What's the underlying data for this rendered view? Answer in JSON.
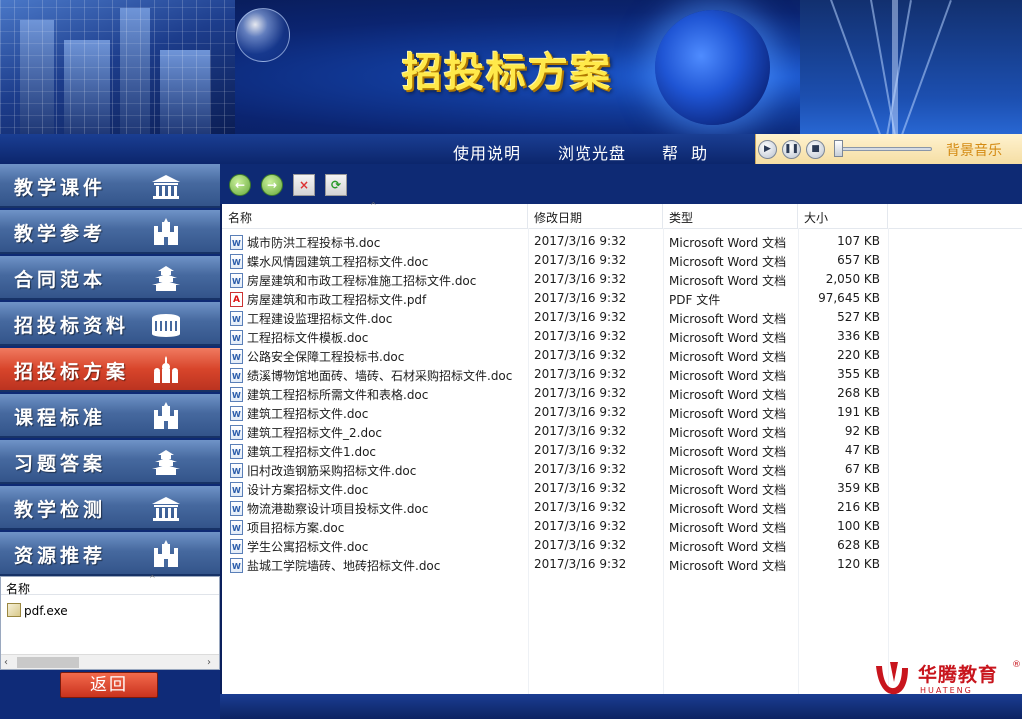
{
  "banner": {
    "title": "招投标方案"
  },
  "menu": {
    "items": [
      "使用说明",
      "浏览光盘",
      "帮  助"
    ]
  },
  "player": {
    "label": "背景音乐",
    "play_icon": "play-icon",
    "pause_icon": "pause-icon",
    "stop_icon": "stop-icon"
  },
  "nav": {
    "items": [
      {
        "label": "教学课件",
        "icon": "temple-icon",
        "active": false
      },
      {
        "label": "教学参考",
        "icon": "palace-icon",
        "active": false
      },
      {
        "label": "合同范本",
        "icon": "pagoda-icon",
        "active": false
      },
      {
        "label": "招投标资料",
        "icon": "colosseum-icon",
        "active": false
      },
      {
        "label": "招投标方案",
        "icon": "kremlin-icon",
        "active": true
      },
      {
        "label": "课程标准",
        "icon": "palace-icon",
        "active": false
      },
      {
        "label": "习题答案",
        "icon": "pagoda-icon",
        "active": false
      },
      {
        "label": "教学检测",
        "icon": "temple-icon",
        "active": false
      },
      {
        "label": "资源推荐",
        "icon": "palace-icon",
        "active": false
      }
    ],
    "active_color": "#d8452b"
  },
  "mini_panel": {
    "header": "名称",
    "items": [
      "pdf.exe"
    ]
  },
  "back_button": {
    "label": "返回"
  },
  "toolbar": {
    "back_icon": "arrow-left-icon",
    "forward_icon": "arrow-right-icon",
    "delete_icon": "delete-icon",
    "refresh_icon": "refresh-icon"
  },
  "file_list": {
    "columns": [
      "名称",
      "修改日期",
      "类型",
      "大小"
    ],
    "rows": [
      {
        "name": "城市防洪工程投标书.doc",
        "date": "2017/3/16 9:32",
        "type": "Microsoft Word 文档",
        "size": "107 KB",
        "kind": "doc"
      },
      {
        "name": "蝶水风情园建筑工程招标文件.doc",
        "date": "2017/3/16 9:32",
        "type": "Microsoft Word 文档",
        "size": "657 KB",
        "kind": "doc"
      },
      {
        "name": "房屋建筑和市政工程标准施工招标文件.doc",
        "date": "2017/3/16 9:32",
        "type": "Microsoft Word 文档",
        "size": "2,050 KB",
        "kind": "doc"
      },
      {
        "name": "房屋建筑和市政工程招标文件.pdf",
        "date": "2017/3/16 9:32",
        "type": "PDF 文件",
        "size": "97,645 KB",
        "kind": "pdf"
      },
      {
        "name": "工程建设监理招标文件.doc",
        "date": "2017/3/16 9:32",
        "type": "Microsoft Word 文档",
        "size": "527 KB",
        "kind": "doc"
      },
      {
        "name": "工程招标文件模板.doc",
        "date": "2017/3/16 9:32",
        "type": "Microsoft Word 文档",
        "size": "336 KB",
        "kind": "doc"
      },
      {
        "name": "公路安全保障工程投标书.doc",
        "date": "2017/3/16 9:32",
        "type": "Microsoft Word 文档",
        "size": "220 KB",
        "kind": "doc"
      },
      {
        "name": "绩溪博物馆地面砖、墙砖、石材采购招标文件.doc",
        "date": "2017/3/16 9:32",
        "type": "Microsoft Word 文档",
        "size": "355 KB",
        "kind": "doc"
      },
      {
        "name": "建筑工程招标所需文件和表格.doc",
        "date": "2017/3/16 9:32",
        "type": "Microsoft Word 文档",
        "size": "268 KB",
        "kind": "doc"
      },
      {
        "name": "建筑工程招标文件.doc",
        "date": "2017/3/16 9:32",
        "type": "Microsoft Word 文档",
        "size": "191 KB",
        "kind": "doc"
      },
      {
        "name": "建筑工程招标文件_2.doc",
        "date": "2017/3/16 9:32",
        "type": "Microsoft Word 文档",
        "size": "92 KB",
        "kind": "doc"
      },
      {
        "name": "建筑工程招标文件1.doc",
        "date": "2017/3/16 9:32",
        "type": "Microsoft Word 文档",
        "size": "47 KB",
        "kind": "doc"
      },
      {
        "name": "旧村改造钢筋采购招标文件.doc",
        "date": "2017/3/16 9:32",
        "type": "Microsoft Word 文档",
        "size": "67 KB",
        "kind": "doc"
      },
      {
        "name": "设计方案招标文件.doc",
        "date": "2017/3/16 9:32",
        "type": "Microsoft Word 文档",
        "size": "359 KB",
        "kind": "doc"
      },
      {
        "name": "物流港勘察设计项目投标文件.doc",
        "date": "2017/3/16 9:32",
        "type": "Microsoft Word 文档",
        "size": "216 KB",
        "kind": "doc"
      },
      {
        "name": "项目招标方案.doc",
        "date": "2017/3/16 9:32",
        "type": "Microsoft Word 文档",
        "size": "100 KB",
        "kind": "doc"
      },
      {
        "name": "学生公寓招标文件.doc",
        "date": "2017/3/16 9:32",
        "type": "Microsoft Word 文档",
        "size": "628 KB",
        "kind": "doc"
      },
      {
        "name": "盐城工学院墙砖、地砖招标文件.doc",
        "date": "2017/3/16 9:32",
        "type": "Microsoft Word 文档",
        "size": "120 KB",
        "kind": "doc"
      }
    ]
  },
  "logo": {
    "name": "华腾教育",
    "reg": "®"
  },
  "colors": {
    "banner_blue": "#0b2470",
    "title_yellow": "#ffe94a",
    "accent_red": "#c8151d"
  }
}
